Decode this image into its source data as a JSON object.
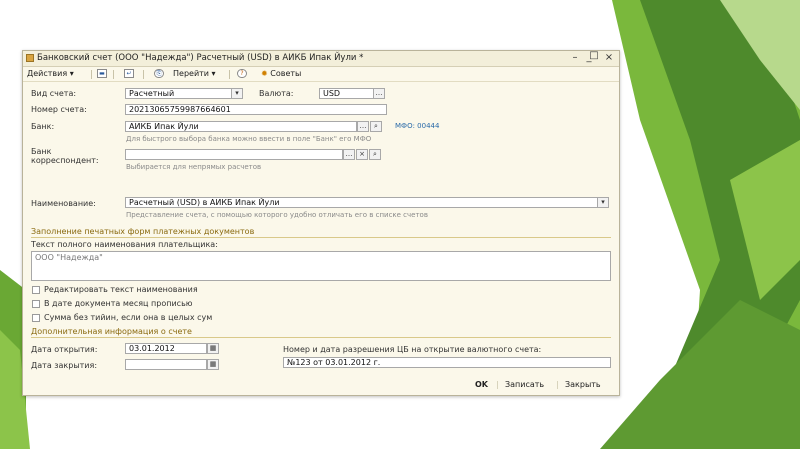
{
  "window": {
    "title": "Банковский счет (ООО \"Надежда\")  Расчетный (USD) в АИКБ Ипак Йули *",
    "controls": {
      "menu": "–",
      "minimize": "_",
      "maximize": "□",
      "close": "×"
    }
  },
  "toolbar": {
    "actions_label": "Действия",
    "goto_label": "Перейти",
    "tips_label": "Советы"
  },
  "form": {
    "account_type": {
      "label": "Вид счета:",
      "value": "Расчетный"
    },
    "currency": {
      "label": "Валюта:",
      "value": "USD"
    },
    "account_number": {
      "label": "Номер счета:",
      "value": "20213065759987664601"
    },
    "bank": {
      "label": "Банк:",
      "value": "АИКБ Ипак Йули",
      "hint": "Для быстрого выбора банка можно ввести в поле \"Банк\" его МФО",
      "mfo": "МФО: 00444"
    },
    "correspondent_bank": {
      "label_line1": "Банк",
      "label_line2": "корреспондент:",
      "value": "",
      "hint": "Выбирается для непрямых расчетов"
    },
    "name": {
      "label": "Наименование:",
      "value": "Расчетный (USD) в АИКБ Ипак Йули",
      "hint": "Представление счета, с помощью которого удобно отличать его в списке счетов"
    }
  },
  "print_section": {
    "title": "Заполнение печатных форм платежных документов",
    "payer_text_label": "Текст полного наименования плательщика:",
    "payer_text_value": "ООО \"Надежда\"",
    "checkboxes": [
      {
        "label": "Редактировать текст наименования"
      },
      {
        "label": "В дате документа месяц прописью"
      },
      {
        "label": "Сумма без тийин, если она в целых сум"
      }
    ]
  },
  "extra_section": {
    "title": "Дополнительная информация о счете",
    "open_date": {
      "label": "Дата открытия:",
      "value": "03.01.2012"
    },
    "close_date": {
      "label": "Дата закрытия:",
      "value": ""
    },
    "permission": {
      "label": "Номер и дата разрешения ЦБ на открытие валютного счета:",
      "value": "№123 от 03.01.2012 г."
    }
  },
  "footer": {
    "ok_label": "OK",
    "save_label": "Записать",
    "close_label": "Закрыть"
  },
  "colors": {
    "green_dark": "#4e8a2c",
    "green_mid": "#7ab83c",
    "green_light": "#b7d98c",
    "window_bg": "#fbf8ea",
    "section_text": "#8a6a10",
    "link": "#2a6aa8"
  }
}
